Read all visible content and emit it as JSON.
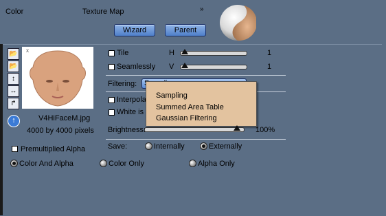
{
  "header": {
    "section_label": "Color",
    "map_label": "Texture Map",
    "wizard_label": "Wizard",
    "parent_label": "Parent"
  },
  "image": {
    "filename": "V4HiFaceM.jpg",
    "dimensions": "4000 by 4000 pixels"
  },
  "tiling": {
    "tile_label": "Tile",
    "seamlessly_label": "Seamlessly",
    "h_label": "H",
    "v_label": "V",
    "h_value": "1",
    "v_value": "1"
  },
  "filtering": {
    "label": "Filtering:",
    "selected": "Sampling",
    "options": [
      "Sampling",
      "Summed Area Table",
      "Gaussian Filtering"
    ]
  },
  "options": {
    "interpolate_label": "Interpola",
    "white_label": "White is"
  },
  "brightness": {
    "label": "Brightness:",
    "value": "100%",
    "level_percent": 100
  },
  "save": {
    "label": "Save:",
    "internally_label": "Internally",
    "externally_label": "Externally",
    "selected": "Externally"
  },
  "premultiplied_label": "Premultiplied Alpha",
  "channel_mode": {
    "options": [
      "Color And Alpha",
      "Color Only",
      "Alpha Only"
    ],
    "selected": "Color And Alpha"
  }
}
